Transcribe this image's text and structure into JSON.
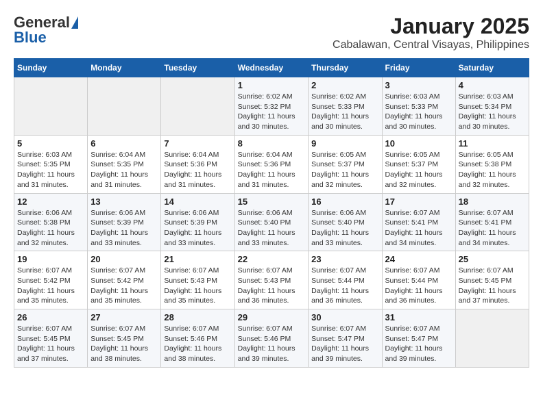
{
  "header": {
    "logo_line1": "General",
    "logo_line2": "Blue",
    "title": "January 2025",
    "subtitle": "Cabalawan, Central Visayas, Philippines"
  },
  "calendar": {
    "days_of_week": [
      "Sunday",
      "Monday",
      "Tuesday",
      "Wednesday",
      "Thursday",
      "Friday",
      "Saturday"
    ],
    "weeks": [
      [
        {
          "day": "",
          "sunrise": "",
          "sunset": "",
          "daylight": ""
        },
        {
          "day": "",
          "sunrise": "",
          "sunset": "",
          "daylight": ""
        },
        {
          "day": "",
          "sunrise": "",
          "sunset": "",
          "daylight": ""
        },
        {
          "day": "1",
          "sunrise": "Sunrise: 6:02 AM",
          "sunset": "Sunset: 5:32 PM",
          "daylight": "Daylight: 11 hours and 30 minutes."
        },
        {
          "day": "2",
          "sunrise": "Sunrise: 6:02 AM",
          "sunset": "Sunset: 5:33 PM",
          "daylight": "Daylight: 11 hours and 30 minutes."
        },
        {
          "day": "3",
          "sunrise": "Sunrise: 6:03 AM",
          "sunset": "Sunset: 5:33 PM",
          "daylight": "Daylight: 11 hours and 30 minutes."
        },
        {
          "day": "4",
          "sunrise": "Sunrise: 6:03 AM",
          "sunset": "Sunset: 5:34 PM",
          "daylight": "Daylight: 11 hours and 30 minutes."
        }
      ],
      [
        {
          "day": "5",
          "sunrise": "Sunrise: 6:03 AM",
          "sunset": "Sunset: 5:35 PM",
          "daylight": "Daylight: 11 hours and 31 minutes."
        },
        {
          "day": "6",
          "sunrise": "Sunrise: 6:04 AM",
          "sunset": "Sunset: 5:35 PM",
          "daylight": "Daylight: 11 hours and 31 minutes."
        },
        {
          "day": "7",
          "sunrise": "Sunrise: 6:04 AM",
          "sunset": "Sunset: 5:36 PM",
          "daylight": "Daylight: 11 hours and 31 minutes."
        },
        {
          "day": "8",
          "sunrise": "Sunrise: 6:04 AM",
          "sunset": "Sunset: 5:36 PM",
          "daylight": "Daylight: 11 hours and 31 minutes."
        },
        {
          "day": "9",
          "sunrise": "Sunrise: 6:05 AM",
          "sunset": "Sunset: 5:37 PM",
          "daylight": "Daylight: 11 hours and 32 minutes."
        },
        {
          "day": "10",
          "sunrise": "Sunrise: 6:05 AM",
          "sunset": "Sunset: 5:37 PM",
          "daylight": "Daylight: 11 hours and 32 minutes."
        },
        {
          "day": "11",
          "sunrise": "Sunrise: 6:05 AM",
          "sunset": "Sunset: 5:38 PM",
          "daylight": "Daylight: 11 hours and 32 minutes."
        }
      ],
      [
        {
          "day": "12",
          "sunrise": "Sunrise: 6:06 AM",
          "sunset": "Sunset: 5:38 PM",
          "daylight": "Daylight: 11 hours and 32 minutes."
        },
        {
          "day": "13",
          "sunrise": "Sunrise: 6:06 AM",
          "sunset": "Sunset: 5:39 PM",
          "daylight": "Daylight: 11 hours and 33 minutes."
        },
        {
          "day": "14",
          "sunrise": "Sunrise: 6:06 AM",
          "sunset": "Sunset: 5:39 PM",
          "daylight": "Daylight: 11 hours and 33 minutes."
        },
        {
          "day": "15",
          "sunrise": "Sunrise: 6:06 AM",
          "sunset": "Sunset: 5:40 PM",
          "daylight": "Daylight: 11 hours and 33 minutes."
        },
        {
          "day": "16",
          "sunrise": "Sunrise: 6:06 AM",
          "sunset": "Sunset: 5:40 PM",
          "daylight": "Daylight: 11 hours and 33 minutes."
        },
        {
          "day": "17",
          "sunrise": "Sunrise: 6:07 AM",
          "sunset": "Sunset: 5:41 PM",
          "daylight": "Daylight: 11 hours and 34 minutes."
        },
        {
          "day": "18",
          "sunrise": "Sunrise: 6:07 AM",
          "sunset": "Sunset: 5:41 PM",
          "daylight": "Daylight: 11 hours and 34 minutes."
        }
      ],
      [
        {
          "day": "19",
          "sunrise": "Sunrise: 6:07 AM",
          "sunset": "Sunset: 5:42 PM",
          "daylight": "Daylight: 11 hours and 35 minutes."
        },
        {
          "day": "20",
          "sunrise": "Sunrise: 6:07 AM",
          "sunset": "Sunset: 5:42 PM",
          "daylight": "Daylight: 11 hours and 35 minutes."
        },
        {
          "day": "21",
          "sunrise": "Sunrise: 6:07 AM",
          "sunset": "Sunset: 5:43 PM",
          "daylight": "Daylight: 11 hours and 35 minutes."
        },
        {
          "day": "22",
          "sunrise": "Sunrise: 6:07 AM",
          "sunset": "Sunset: 5:43 PM",
          "daylight": "Daylight: 11 hours and 36 minutes."
        },
        {
          "day": "23",
          "sunrise": "Sunrise: 6:07 AM",
          "sunset": "Sunset: 5:44 PM",
          "daylight": "Daylight: 11 hours and 36 minutes."
        },
        {
          "day": "24",
          "sunrise": "Sunrise: 6:07 AM",
          "sunset": "Sunset: 5:44 PM",
          "daylight": "Daylight: 11 hours and 36 minutes."
        },
        {
          "day": "25",
          "sunrise": "Sunrise: 6:07 AM",
          "sunset": "Sunset: 5:45 PM",
          "daylight": "Daylight: 11 hours and 37 minutes."
        }
      ],
      [
        {
          "day": "26",
          "sunrise": "Sunrise: 6:07 AM",
          "sunset": "Sunset: 5:45 PM",
          "daylight": "Daylight: 11 hours and 37 minutes."
        },
        {
          "day": "27",
          "sunrise": "Sunrise: 6:07 AM",
          "sunset": "Sunset: 5:45 PM",
          "daylight": "Daylight: 11 hours and 38 minutes."
        },
        {
          "day": "28",
          "sunrise": "Sunrise: 6:07 AM",
          "sunset": "Sunset: 5:46 PM",
          "daylight": "Daylight: 11 hours and 38 minutes."
        },
        {
          "day": "29",
          "sunrise": "Sunrise: 6:07 AM",
          "sunset": "Sunset: 5:46 PM",
          "daylight": "Daylight: 11 hours and 39 minutes."
        },
        {
          "day": "30",
          "sunrise": "Sunrise: 6:07 AM",
          "sunset": "Sunset: 5:47 PM",
          "daylight": "Daylight: 11 hours and 39 minutes."
        },
        {
          "day": "31",
          "sunrise": "Sunrise: 6:07 AM",
          "sunset": "Sunset: 5:47 PM",
          "daylight": "Daylight: 11 hours and 39 minutes."
        },
        {
          "day": "",
          "sunrise": "",
          "sunset": "",
          "daylight": ""
        }
      ]
    ]
  }
}
